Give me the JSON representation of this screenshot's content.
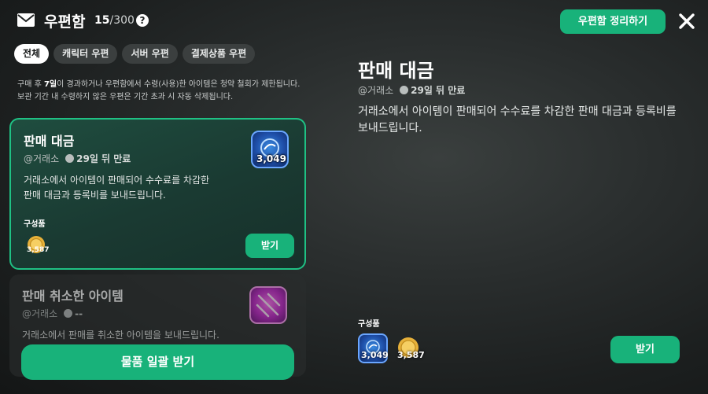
{
  "header": {
    "title": "우편함",
    "count_current": "15",
    "count_total": "/300",
    "organize_label": "우편함 정리하기"
  },
  "tabs": [
    {
      "label": "전체",
      "active": true
    },
    {
      "label": "캐릭터 우편",
      "active": false
    },
    {
      "label": "서버 우편",
      "active": false
    },
    {
      "label": "결제상품 우편",
      "active": false
    }
  ],
  "notice": {
    "line1_pre": "구매 후 ",
    "line1_bold": "7일",
    "line1_post": "이 경과하거나 우편함에서 수령(사용)한 아이템은 청약 철회가 제한됩니다.",
    "line2": "보관 기간 내 수령하지 않은 우편은 기간 초과 시 자동 삭제됩니다."
  },
  "mail_list": [
    {
      "title": "판매 대금",
      "sender": "@거래소",
      "expiry": "29일 뒤 만료",
      "body": "거래소에서 아이템이 판매되어 수수료를 차감한 판매 대금과 등록비를 보내드립니다.",
      "components_label": "구성품",
      "item_value": "3,049",
      "coin_value": "3,587",
      "receive_label": "받기",
      "selected": true
    },
    {
      "title": "판매 취소한 아이템",
      "sender": "@거래소",
      "expiry": "--",
      "body": "거래소에서 판매를 취소한 아이템을 보내드립니다.",
      "selected": false
    }
  ],
  "collect_all_label": "물품 일괄 받기",
  "detail": {
    "title": "판매 대금",
    "sender": "@거래소",
    "expiry": "29일 뒤 만료",
    "body": "거래소에서 아이템이 판매되어 수수료를 차감한 판매 대금과 등록비를 보내드립니다.",
    "components_label": "구성품",
    "item_value": "3,049",
    "coin_value": "3,587",
    "receive_label": "받기"
  },
  "icons": {
    "mail": "mail-icon",
    "help": "help-icon",
    "close": "close-icon",
    "clock": "clock-icon",
    "coin": "coin-icon",
    "orb": "orb-item-icon",
    "crossbow": "crossbow-item-icon"
  },
  "colors": {
    "accent": "#18b27a",
    "selected_border": "#1fc184"
  }
}
